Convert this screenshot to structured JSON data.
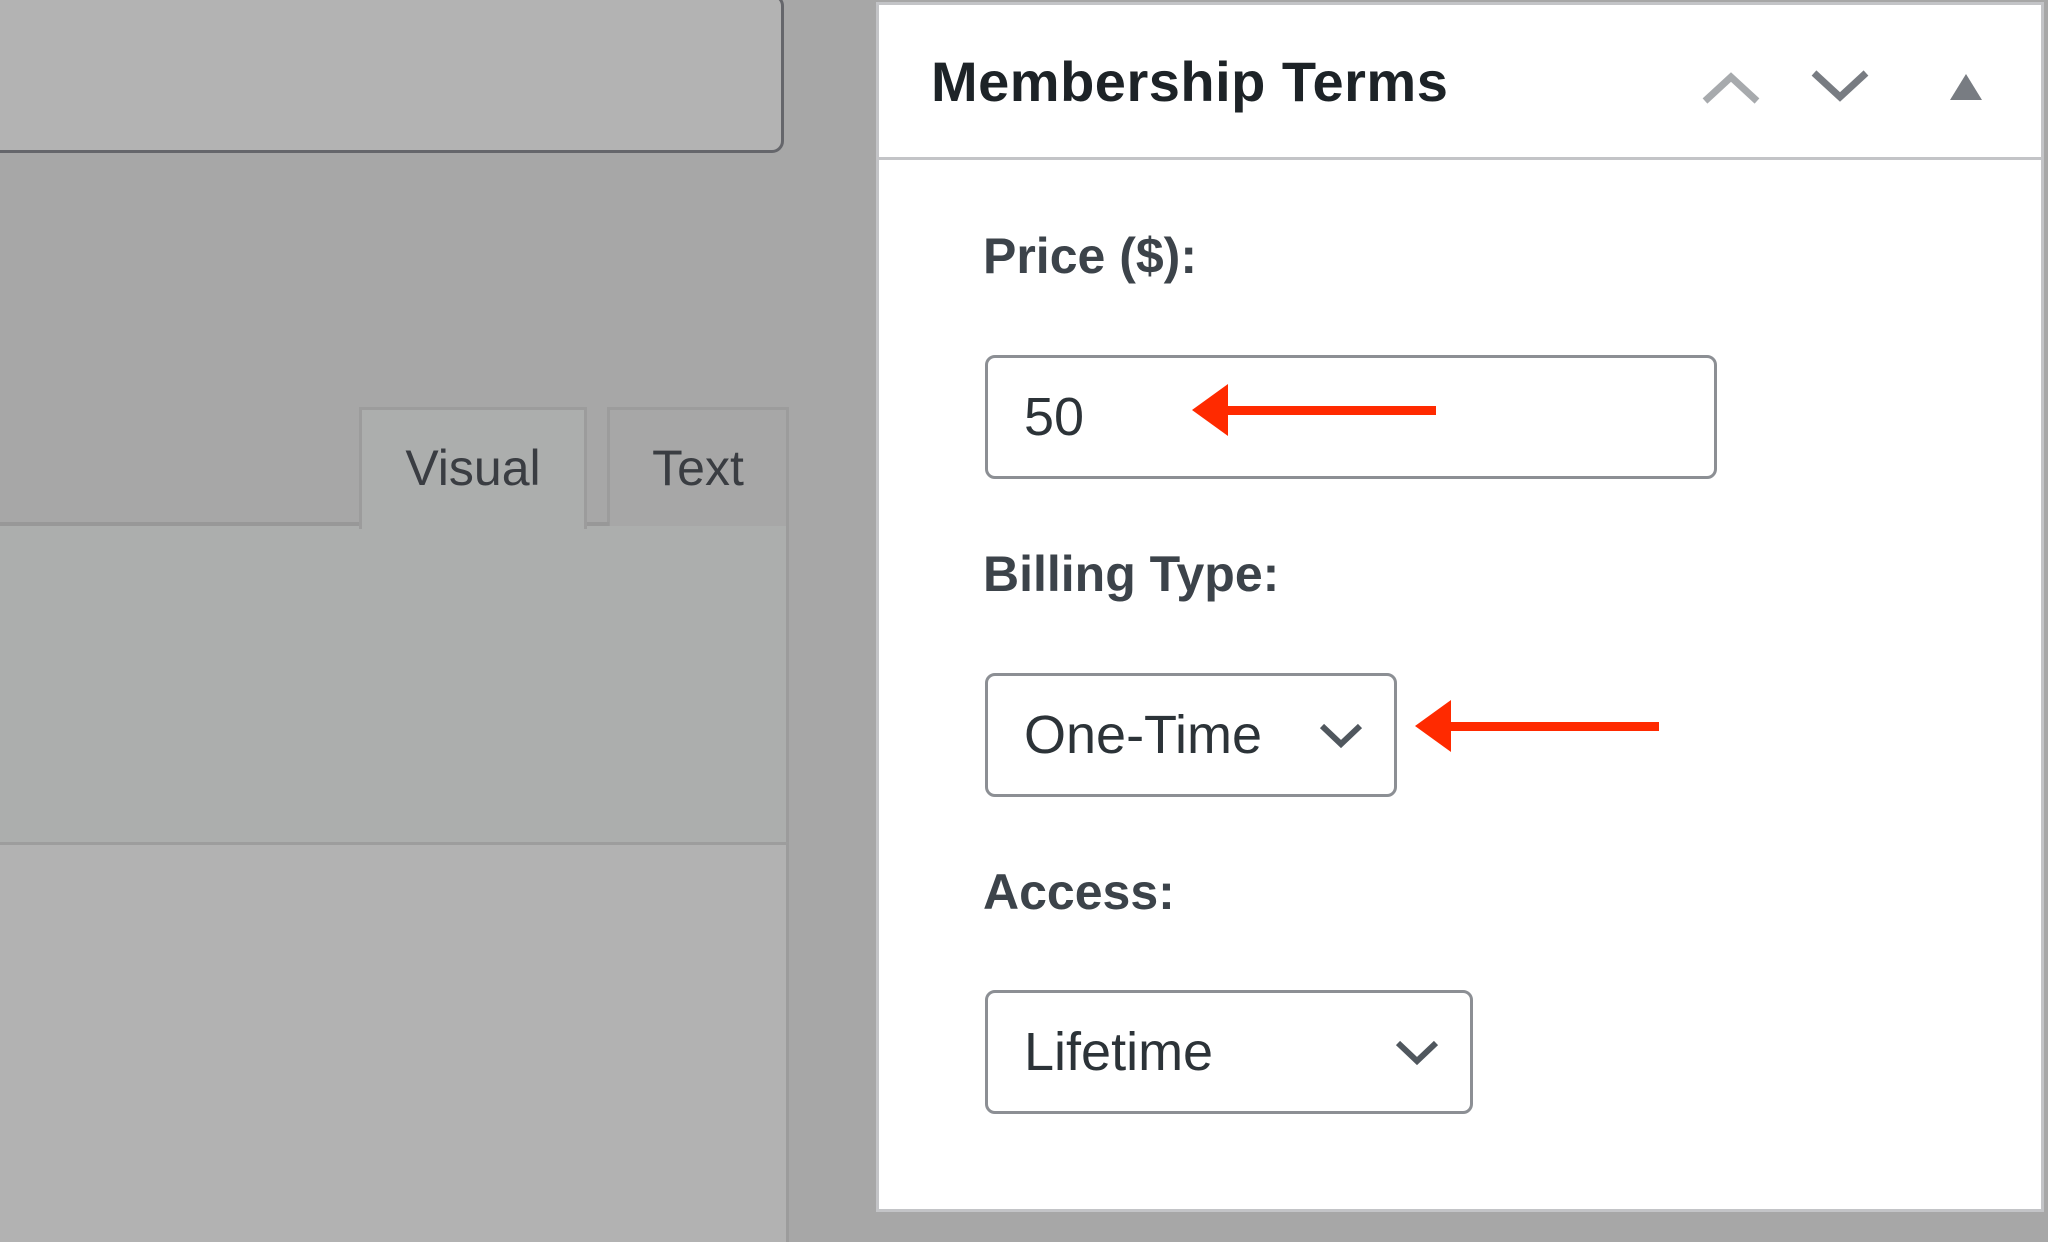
{
  "editor": {
    "title_input_value": "",
    "tabs": [
      {
        "label": "Visual",
        "active": true
      },
      {
        "label": "Text",
        "active": false
      }
    ]
  },
  "panel": {
    "title": "Membership Terms",
    "controls": {
      "move_up": "chevron-up-icon",
      "move_down": "chevron-down-icon",
      "toggle": "triangle-up-icon"
    },
    "fields": {
      "price": {
        "label": "Price ($):",
        "value": "50"
      },
      "billing_type": {
        "label": "Billing Type:",
        "value": "One-Time"
      },
      "access": {
        "label": "Access:",
        "value": "Lifetime"
      }
    }
  },
  "annotations": {
    "arrow_color": "#ff2a00",
    "arrows": [
      "price-input",
      "billing-type-select"
    ]
  },
  "colors": {
    "overlay_gray": "#a7a7a7",
    "panel_bg": "#ffffff",
    "label_text": "#3c434a",
    "title_text": "#1d2327",
    "field_border": "#8c8f94"
  }
}
